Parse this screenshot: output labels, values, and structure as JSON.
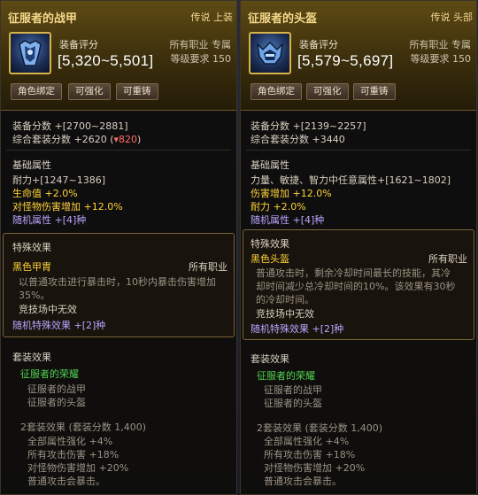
{
  "colors": {
    "gold": "#f4d98a",
    "yellow": "#ffd23a",
    "purple": "#b9a6ff",
    "green": "#4fd34f",
    "red": "#ff6a6a"
  },
  "left": {
    "title": "征服者的战甲",
    "rarity": "传说 上装",
    "icon": "armor-icon",
    "score_label": "装备评分",
    "score_value": "[5,320~5,501]",
    "job": "所有职业 专属",
    "level": "等级要求 150",
    "buttons": [
      "角色绑定",
      "可强化",
      "可重铸"
    ],
    "equip_score": "装备分数 +[2700~2881]",
    "set_score": "综合套装分数 +2620 (",
    "set_score_delta": "▾820",
    "set_score_close": ")",
    "base_title": "基础属性",
    "base_attrs": [
      "耐力+[1247~1386]",
      "生命值 +2.0%",
      "对怪物伤害增加 +12.0%",
      "随机属性 +[4]种"
    ],
    "special_title": "特殊效果",
    "special_name": "黑色甲胄",
    "special_job": "所有职业",
    "special_desc1": "以普通攻击进行暴击时，10秒内暴击伤害增加",
    "special_desc2": "35%。",
    "special_pvp": "竞技场中无效",
    "special_random": "随机特殊效果 +[2]种",
    "set_title": "套装效果",
    "set_name": "征服者的荣耀",
    "set_items": [
      "征服者的战甲",
      "征服者的头盔"
    ],
    "set_bonus_title": "2套装效果 (套装分数 1,400)",
    "set_bonus": [
      "全部属性强化 +4%",
      "所有攻击伤害 +18%",
      "对怪物伤害增加 +20%",
      "普通攻击会暴击。"
    ]
  },
  "right": {
    "title": "征服者的头盔",
    "rarity": "传说 头部",
    "icon": "helmet-icon",
    "score_label": "装备评分",
    "score_value": "[5,579~5,697]",
    "job": "所有职业 专属",
    "level": "等级要求 150",
    "buttons": [
      "角色绑定",
      "可强化",
      "可重铸"
    ],
    "equip_score": "装备分数 +[2139~2257]",
    "set_score": "综合套装分数 +3440",
    "base_title": "基础属性",
    "base_attrs": [
      "力量、敏捷、智力中任意属性+[1621~1802]",
      "伤害增加 +12.0%",
      "耐力 +2.0%",
      "随机属性 +[4]种"
    ],
    "special_title": "特殊效果",
    "special_name": "黑色头盔",
    "special_job": "所有职业",
    "special_desc1": "普通攻击时，剩余冷却时间最长的技能，其冷",
    "special_desc2": "却时间减少总冷却时间的10%。该效果有30秒",
    "special_desc3": "的冷却时间。",
    "special_pvp": "竞技场中无效",
    "special_random": "随机特殊效果 +[2]种",
    "set_title": "套装效果",
    "set_name": "征服者的荣耀",
    "set_items": [
      "征服者的战甲",
      "征服者的头盔"
    ],
    "set_bonus_title": "2套装效果 (套装分数 1,400)",
    "set_bonus": [
      "全部属性强化 +4%",
      "所有攻击伤害 +18%",
      "对怪物伤害增加 +20%",
      "普通攻击会暴击。"
    ]
  }
}
